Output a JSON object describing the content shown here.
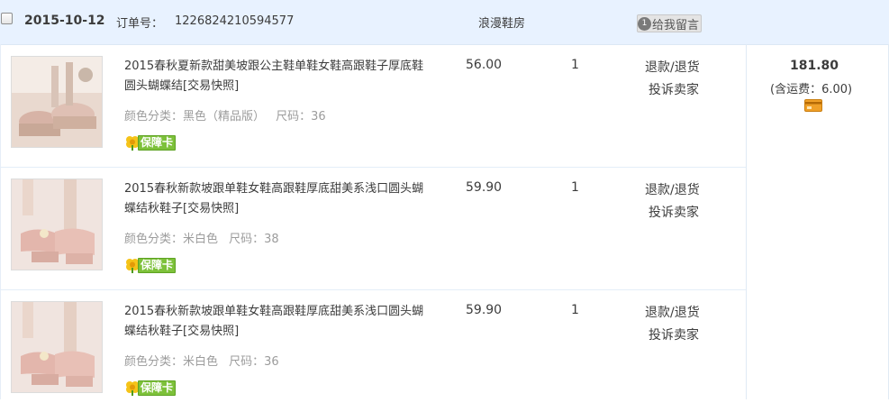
{
  "order": {
    "date": "2015-10-12",
    "order_label": "订单号：",
    "order_number": "1226824210594577",
    "shop_name": "浪漫鞋房",
    "message_button": "给我留言",
    "message_badge": "1",
    "total": "181.80",
    "shipping": "(含运费：6.00)"
  },
  "items": [
    {
      "title": "2015春秋夏新款甜美坡跟公主鞋单鞋女鞋高跟鞋子厚底鞋圆头蝴蝶结[交易快照]",
      "color": "颜色分类：黑色（精品版）",
      "size": "尺码：36",
      "badge": "保障卡",
      "price": "56.00",
      "qty": "1",
      "action_refund": "退款/退货",
      "action_complain": "投诉卖家"
    },
    {
      "title": "2015春秋新款坡跟单鞋女鞋高跟鞋厚底甜美系浅口圆头蝴蝶结秋鞋子[交易快照]",
      "color": "颜色分类：米白色",
      "size": "尺码：38",
      "badge": "保障卡",
      "price": "59.90",
      "qty": "1",
      "action_refund": "退款/退货",
      "action_complain": "投诉卖家"
    },
    {
      "title": "2015春秋新款坡跟单鞋女鞋高跟鞋厚底甜美系浅口圆头蝴蝶结秋鞋子[交易快照]",
      "color": "颜色分类：米白色",
      "size": "尺码：36",
      "badge": "保障卡",
      "price": "59.90",
      "qty": "1",
      "action_refund": "退款/退货",
      "action_complain": "投诉卖家"
    }
  ],
  "colors": {
    "header_bg": "#e8f2ff",
    "badge_green": "#7dc13a",
    "card_icon": "#f0a028"
  }
}
